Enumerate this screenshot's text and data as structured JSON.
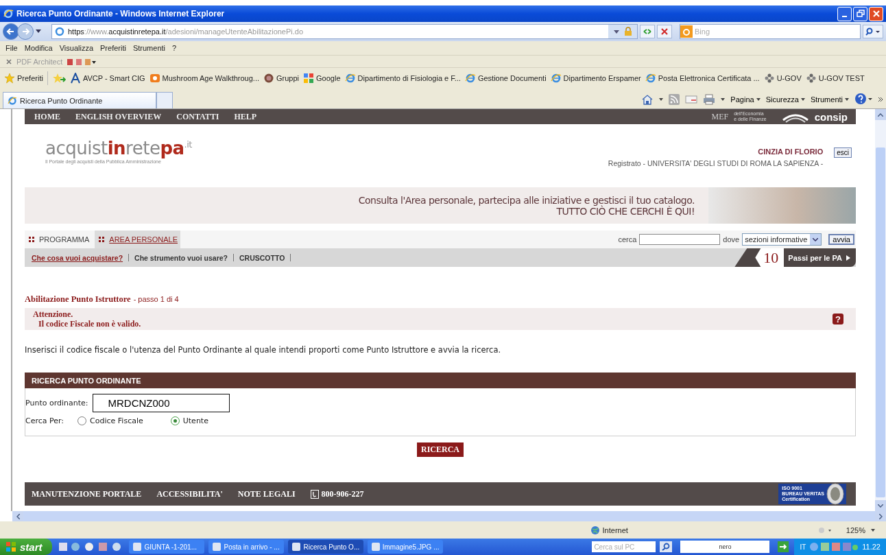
{
  "window": {
    "title": "Ricerca Punto Ordinante - Windows Internet Explorer"
  },
  "address_bar": {
    "url_parts": [
      {
        "text": "https",
        "dim": false
      },
      {
        "text": "://www.",
        "dim": true
      },
      {
        "text": "acquistinretepa.it",
        "dim": false
      },
      {
        "text": "/adesioni/manageUtenteAbilitazionePi.do",
        "dim": true
      }
    ],
    "search_placeholder": "Bing"
  },
  "menu_bar": [
    "File",
    "Modifica",
    "Visualizza",
    "Preferiti",
    "Strumenti",
    "?"
  ],
  "pdf_toolbar": {
    "label": "PDF Architect"
  },
  "favorites": {
    "label": "Preferiti",
    "items": [
      {
        "label": "AVCP - Smart CIG",
        "kind": "letter"
      },
      {
        "label": "Mushroom Age Walkthroug...",
        "kind": "game"
      },
      {
        "label": "Gruppi",
        "kind": "circle"
      },
      {
        "label": "Google",
        "kind": "google"
      },
      {
        "label": "Dipartimento di Fisiologia e F...",
        "kind": "ie"
      },
      {
        "label": "Gestione Documenti",
        "kind": "ie"
      },
      {
        "label": "Dipartimento Erspamer",
        "kind": "ie"
      },
      {
        "label": "Posta Elettronica Certificata ...",
        "kind": "ie"
      },
      {
        "label": "U-GOV",
        "kind": "ugov"
      },
      {
        "label": "U-GOV TEST",
        "kind": "ugov"
      }
    ]
  },
  "tab": {
    "title": "Ricerca Punto Ordinante"
  },
  "command_bar": [
    "Pagina",
    "Sicurezza",
    "Strumenti"
  ],
  "site": {
    "top_nav": [
      "HOME",
      "ENGLISH OVERVIEW",
      "CONTATTI",
      "HELP"
    ],
    "mef_logo": {
      "mark": "MEF",
      "line1": "dell'Economia",
      "line2": "e delle Finanze"
    },
    "consip_logo": "consip",
    "logo": {
      "parts": [
        {
          "text": "acquist",
          "accent": false
        },
        {
          "text": "in",
          "accent": true
        },
        {
          "text": "rete",
          "accent": false
        },
        {
          "text": "pa",
          "accent": true
        }
      ],
      "suffix": ".it",
      "tagline": "Il Portale degli acquisti della Pubblica Amministrazione"
    },
    "user": {
      "name": "CINZIA DI FLORIO",
      "org": "Registrato - UNIVERSITA' DEGLI STUDI DI ROMA LA SAPIENZA -",
      "logout": "esci"
    },
    "banner": {
      "line1": "Consulta l'Area personale, partecipa alle iniziative e gestisci il tuo catalogo.",
      "line2": "TUTTO CIÒ CHE CERCHI È QUI!"
    },
    "tabs": [
      {
        "label": "PROGRAMMA",
        "selected": false
      },
      {
        "label": "AREA PERSONALE",
        "selected": true
      }
    ],
    "search": {
      "label": "cerca",
      "where_label": "dove",
      "where_value": "sezioni informative",
      "button": "avvia"
    },
    "subnav": [
      {
        "label": "Che cosa vuoi acquistare?",
        "selected": true
      },
      {
        "label": "Che strumento vuoi usare?",
        "selected": false
      },
      {
        "label": "CRUSCOTTO",
        "selected": false
      }
    ],
    "ten_steps": {
      "number": "10",
      "label": "Passi per le PA"
    }
  },
  "form": {
    "title": "Abilitazione Punto Istruttore",
    "step": "- passo 1 di 4",
    "error_title": "Attenzione.",
    "error_message": "Il codice Fiscale non è valido.",
    "help": "?",
    "instructions": "Inserisci il codice fiscale o l'utenza del Punto Ordinante al quale intendi proporti come Punto Istruttore e avvia la ricerca.",
    "panel_title": "RICERCA PUNTO ORDINANTE",
    "field_label": "Punto ordinante:",
    "field_value": "MRDCNZ000",
    "search_by_label": "Cerca Per:",
    "options": [
      {
        "label": "Codice Fiscale",
        "selected": false
      },
      {
        "label": "Utente",
        "selected": true
      }
    ],
    "submit": "RICERCA"
  },
  "footer": {
    "links": [
      "MANUTENZIONE PORTALE",
      "ACCESSIBILITA'",
      "NOTE LEGALI"
    ],
    "phone": "800-906-227",
    "cert": {
      "line1": "ISO 9001",
      "line2": "BUREAU VERITAS",
      "line3": "Certification"
    }
  },
  "status_bar": {
    "zone": "Internet",
    "zoom": "125%"
  },
  "taskbar": {
    "start": "start",
    "buttons": [
      {
        "label": "GIUNTA -1-201...",
        "selected": false
      },
      {
        "label": "Posta in arrivo - ...",
        "selected": false
      },
      {
        "label": "Ricerca Punto O...",
        "selected": true
      },
      {
        "label": "Immagine5.JPG ...",
        "selected": false
      }
    ],
    "search_placeholder": "Cerca sul PC",
    "nero": "nero",
    "language": "IT",
    "clock": "11.22"
  }
}
